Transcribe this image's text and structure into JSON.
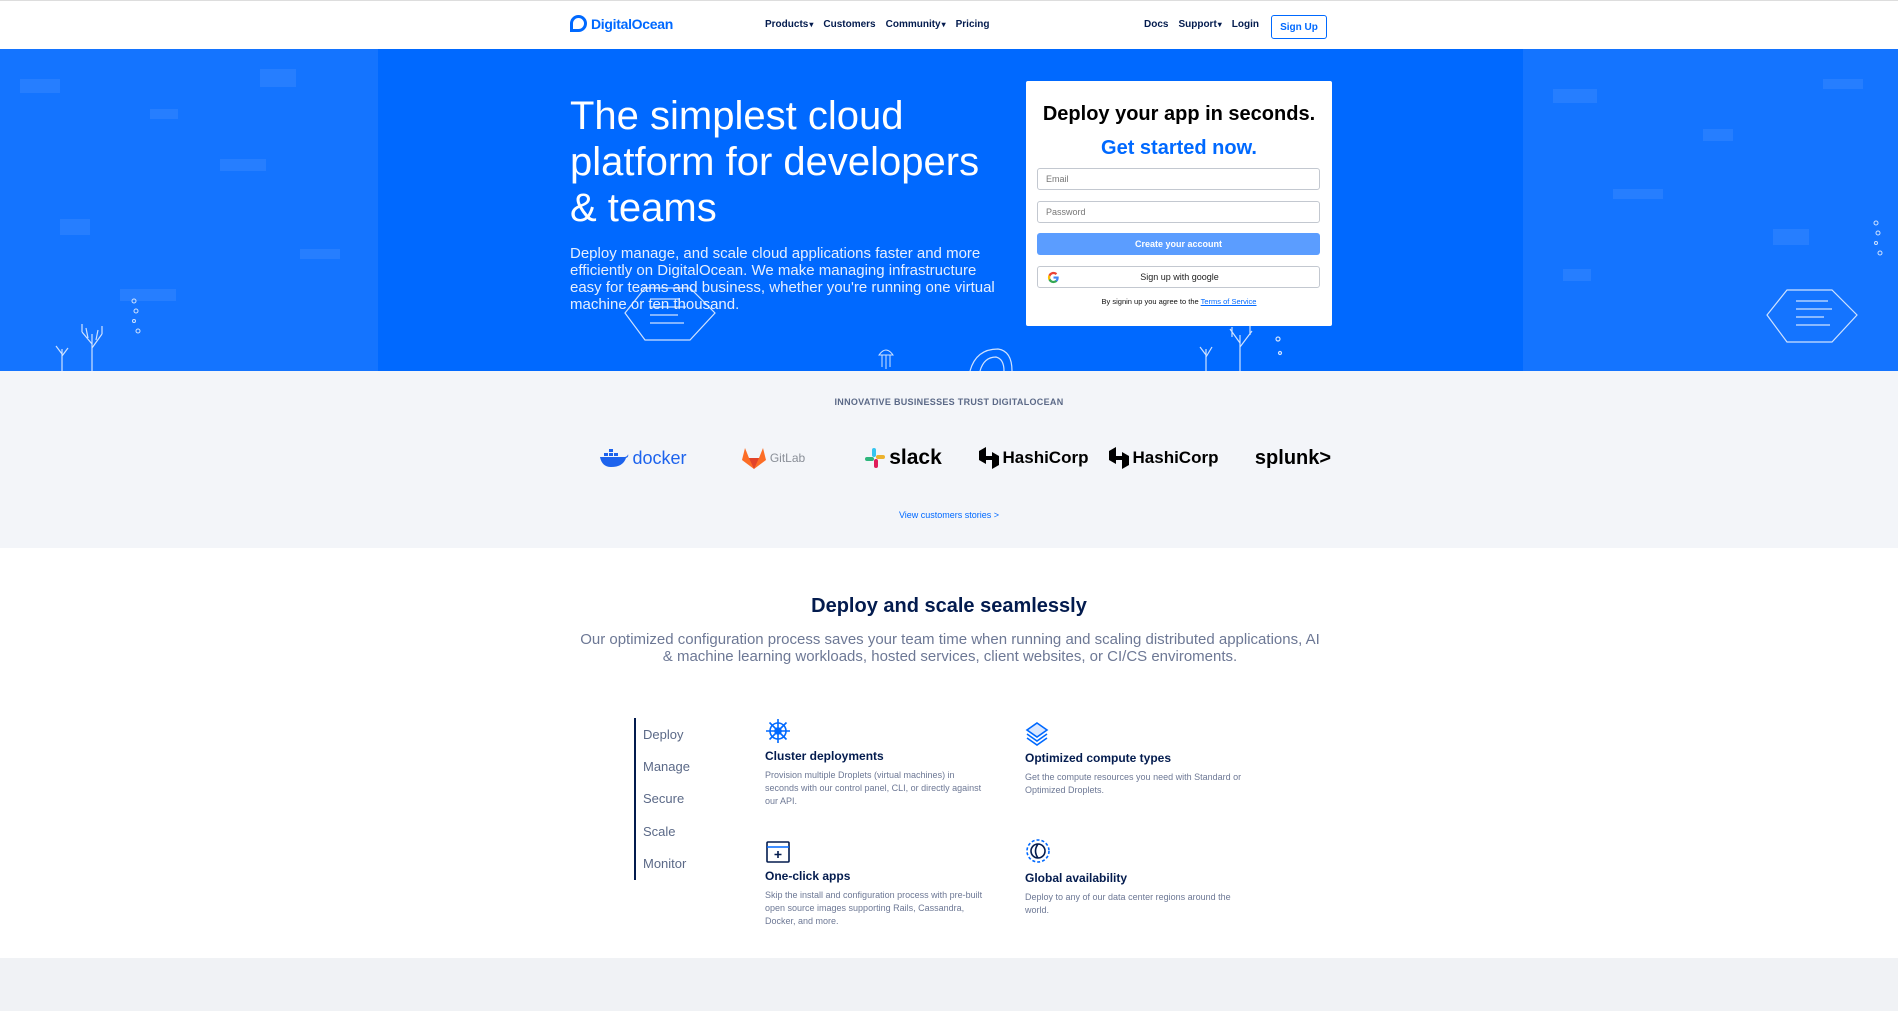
{
  "nav": {
    "logo_text": "DigitalOcean",
    "links": [
      "Products",
      "Customers",
      "Community",
      "Pricing"
    ],
    "right_links": [
      "Docs",
      "Support",
      "Login"
    ],
    "signup_label": "Sign Up",
    "dropdown_icon": "chevron-down-icon"
  },
  "hero": {
    "title": "The simplest cloud platform for developers & teams",
    "subtitle": "Deploy manage, and scale cloud applications faster and more efficiently on DigitalOcean. We make managing infrastructure easy for teams and business, whether you're running one virtual machine or ten thousand.",
    "background_color": "#0069ff"
  },
  "signup_form": {
    "title": "Deploy your app in seconds.",
    "subtitle": "Get started now.",
    "email_placeholder": "Email",
    "password_placeholder": "Password",
    "create_label": "Create your account",
    "google_label": "Sign up with google",
    "terms_text": "By signin up you agree to the",
    "terms_link": "Terms of Service"
  },
  "trust": {
    "title": "INNOVATIVE BUSINESSES TRUST DIGITALOCEAN",
    "logos": [
      "docker",
      "GitLab",
      "slack",
      "HashiCorp",
      "HashiCorp",
      "splunk>"
    ],
    "view_stories": "View customers stories >"
  },
  "deploy": {
    "title": "Deploy and scale seamlessly",
    "description": "Our optimized configuration process saves your team time when running and scaling distributed applications, AI & machine learning workloads, hosted services, client websites, or CI/CS enviroments.",
    "tabs": [
      "Deploy",
      "Manage",
      "Secure",
      "Scale",
      "Monitor"
    ],
    "features": [
      {
        "title": "Cluster deployments",
        "description": "Provision multiple Droplets (virtual machines) in seconds with our control panel, CLI, or directly against our API.",
        "icon": "helm-wheel-icon"
      },
      {
        "title": "Optimized compute types",
        "description": "Get the compute resources you need with Standard or Optimized Droplets.",
        "icon": "stacked-layers-icon"
      },
      {
        "title": "One-click apps",
        "description": "Skip the install and configuration process with pre-built open source images supporting Rails, Cassandra, Docker, and more.",
        "icon": "app-window-plus-icon"
      },
      {
        "title": "Global availability",
        "description": "Deploy to any of our data center regions around the world.",
        "icon": "globe-icon"
      }
    ]
  },
  "colors": {
    "brand": "#0069ff",
    "navy": "#031b4e",
    "muted": "#6d7895"
  }
}
